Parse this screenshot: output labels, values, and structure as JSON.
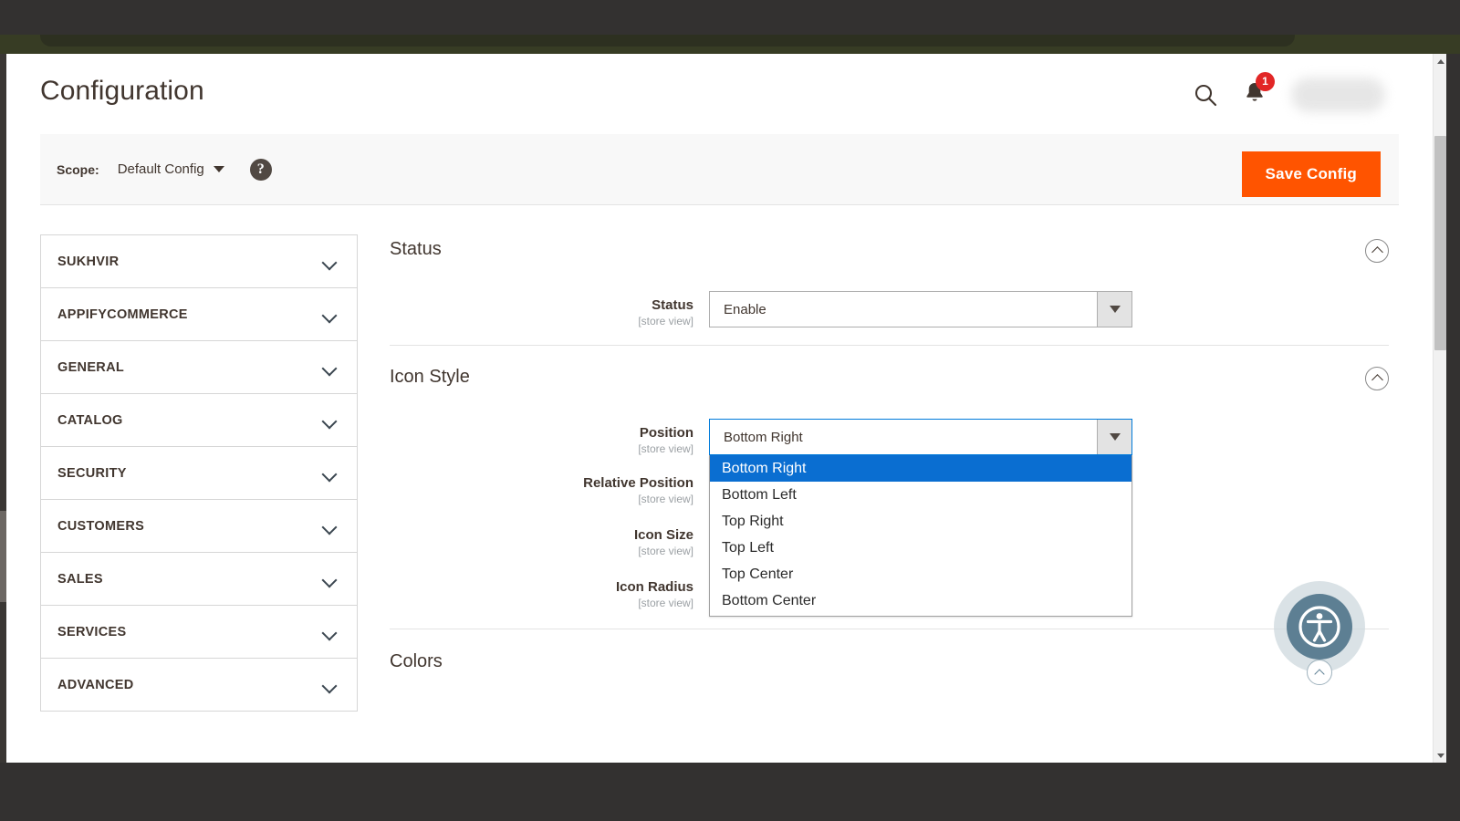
{
  "window": {
    "title": "Configuration"
  },
  "header": {
    "title": "Configuration",
    "search_icon": "search-icon",
    "notifications_icon": "bell-icon",
    "notifications_count": "1",
    "user_menu": ""
  },
  "scope_bar": {
    "label": "Scope:",
    "value": "Default Config",
    "help_icon": "question-mark-icon",
    "help_glyph": "?",
    "save_label": "Save Config",
    "save_color": "#ff5400"
  },
  "sidebar": {
    "items": [
      {
        "label": "SUKHVIR"
      },
      {
        "label": "APPIFYCOMMERCE"
      },
      {
        "label": "GENERAL"
      },
      {
        "label": "CATALOG"
      },
      {
        "label": "SECURITY"
      },
      {
        "label": "CUSTOMERS"
      },
      {
        "label": "SALES"
      },
      {
        "label": "SERVICES"
      },
      {
        "label": "ADVANCED"
      }
    ]
  },
  "main": {
    "sections": [
      {
        "title": "Status"
      },
      {
        "title": "Icon Style"
      },
      {
        "title": "Colors"
      }
    ],
    "status_field": {
      "label": "Status",
      "scope": "[store view]",
      "value": "Enable"
    },
    "position_field": {
      "label": "Position",
      "scope": "[store view]",
      "value": "Bottom Right",
      "highlight_color": "#0a6ed1",
      "options": [
        {
          "label": "Bottom Right",
          "selected": true
        },
        {
          "label": "Bottom Left",
          "selected": false
        },
        {
          "label": "Top Right",
          "selected": false
        },
        {
          "label": "Top Left",
          "selected": false
        },
        {
          "label": "Top Center",
          "selected": false
        },
        {
          "label": "Bottom Center",
          "selected": false
        }
      ]
    },
    "relative_position_field": {
      "label": "Relative Position",
      "scope": "[store view]"
    },
    "icon_size_field": {
      "label": "Icon Size",
      "scope": "[store view]"
    },
    "icon_radius_field": {
      "label": "Icon Radius",
      "scope": "[store view]"
    }
  },
  "accessibility_widget": {
    "icon": "accessibility-person-icon",
    "collapse_icon": "chevron-up-icon",
    "color": "#5d7f93"
  }
}
